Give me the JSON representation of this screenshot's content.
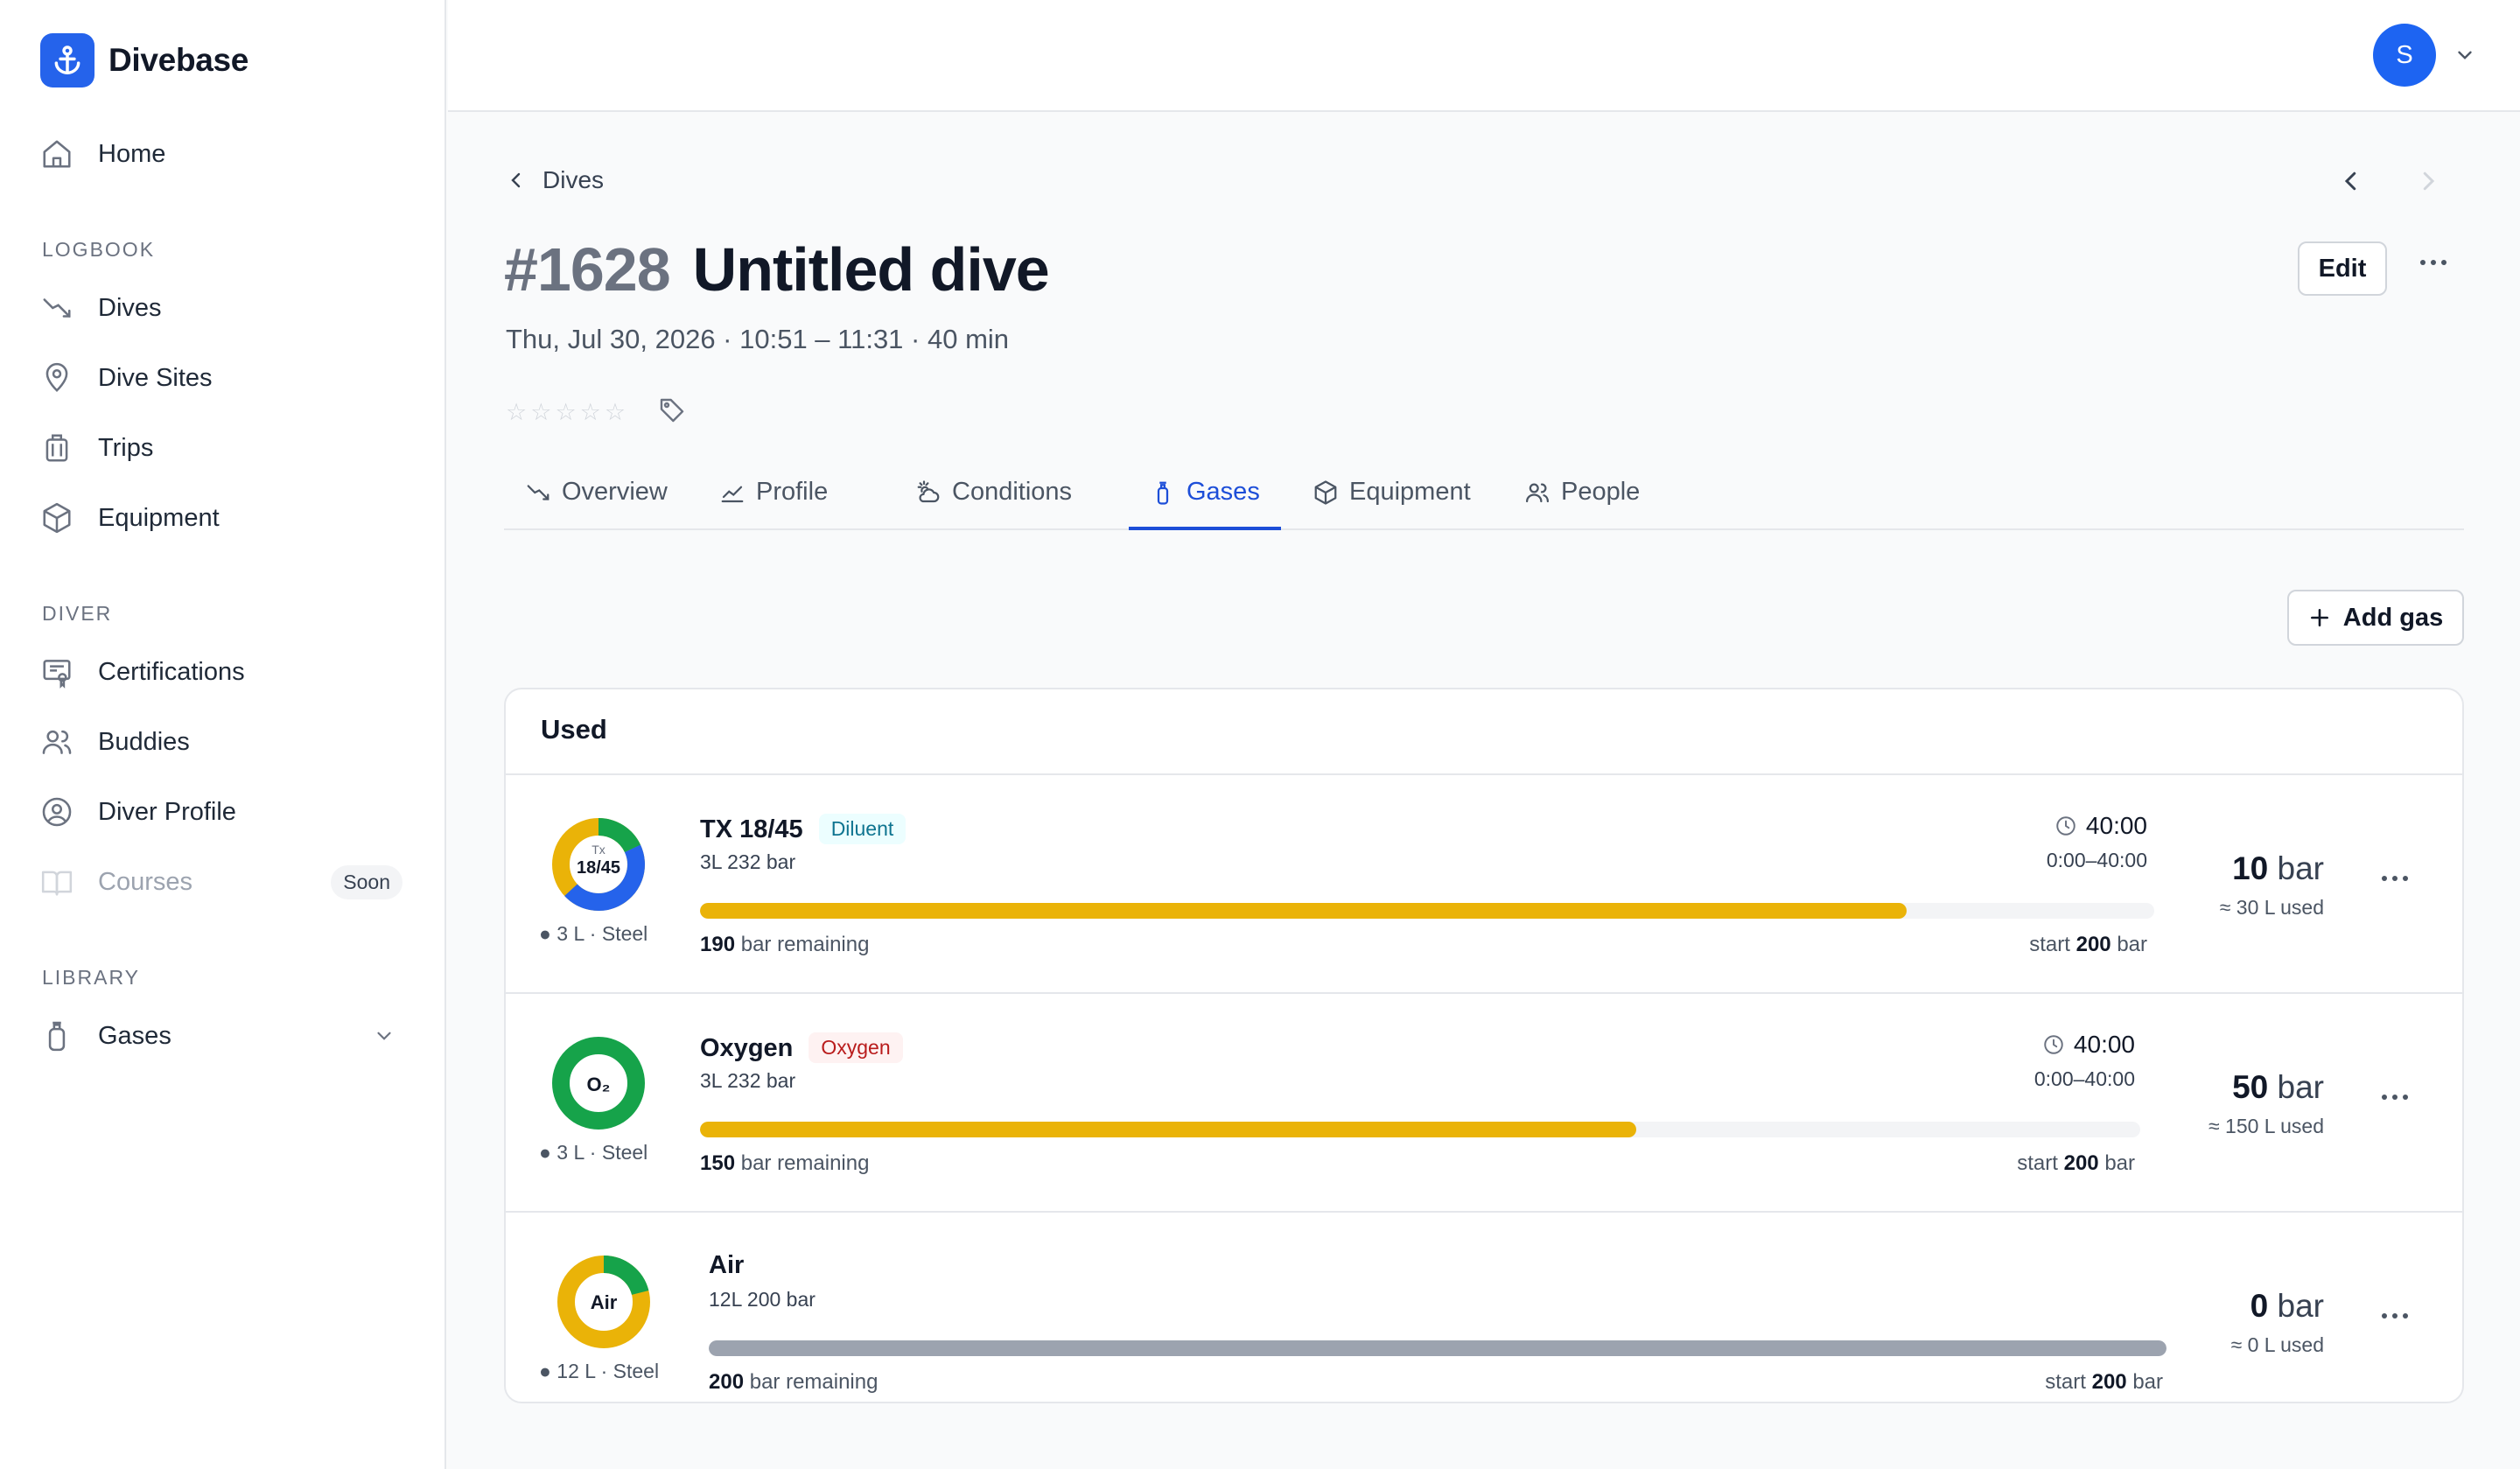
{
  "app": {
    "name": "Divebase"
  },
  "sidebar": {
    "home": "Home",
    "sections": {
      "logbook": "LOGBOOK",
      "diver": "DIVER",
      "library": "LIBRARY"
    },
    "logbook_items": [
      "Dives",
      "Dive Sites",
      "Trips",
      "Equipment"
    ],
    "diver_items": [
      "Certifications",
      "Buddies",
      "Diver Profile",
      "Courses"
    ],
    "courses_badge": "Soon",
    "library_items": [
      "Gases"
    ]
  },
  "topbar": {
    "avatar_initial": "S"
  },
  "header": {
    "back_label": "Dives",
    "dive_number": "#1628",
    "dive_title": "Untitled dive",
    "subtitle": "Thu, Jul 30, 2026 · 10:51 – 11:31 · 40 min",
    "rating": 0,
    "rating_max": 5,
    "edit_label": "Edit"
  },
  "tabs": [
    "Overview",
    "Profile",
    "Conditions",
    "Gases",
    "Equipment",
    "People"
  ],
  "active_tab": "Gases",
  "add_gas_label": "Add gas",
  "used_card": {
    "title": "Used",
    "gases": [
      {
        "donut_top": "Tx",
        "donut_label": "18/45",
        "tank_meta": "3 L · Steel",
        "name": "TX 18/45",
        "badge": "Diluent",
        "spec": "3L 232 bar",
        "time": "40:00",
        "time_range": "0:00–40:00",
        "remaining_value": "190",
        "remaining_text": "bar remaining",
        "start_prefix": "start",
        "start_value": "200",
        "start_unit": "bar",
        "remaining_fraction": 0.83,
        "used_value": "10",
        "used_unit": "bar",
        "used_liters": "≈ 30 L used",
        "bar_color": "#eab308"
      },
      {
        "donut_label": "O₂",
        "tank_meta": "3 L · Steel",
        "name": "Oxygen",
        "badge": "Oxygen",
        "spec": "3L 232 bar",
        "time": "40:00",
        "time_range": "0:00–40:00",
        "remaining_value": "150",
        "remaining_text": "bar remaining",
        "start_prefix": "start",
        "start_value": "200",
        "start_unit": "bar",
        "remaining_fraction": 0.65,
        "used_value": "50",
        "used_unit": "bar",
        "used_liters": "≈ 150 L used",
        "bar_color": "#eab308"
      },
      {
        "donut_label": "Air",
        "tank_meta": "12 L · Steel",
        "name": "Air",
        "spec": "12L 200 bar",
        "remaining_value": "200",
        "remaining_text": "bar remaining",
        "start_prefix": "start",
        "start_value": "200",
        "start_unit": "bar",
        "remaining_fraction": 1.0,
        "used_value": "0",
        "used_unit": "bar",
        "used_liters": "≈ 0 L used",
        "bar_color": "#9ca3af"
      }
    ]
  },
  "colors": {
    "brand": "#2563eb",
    "active_tab": "#1d4ed8",
    "helium": "#2563eb",
    "oxygen": "#16a34a",
    "nitrogen": "#eab308"
  }
}
